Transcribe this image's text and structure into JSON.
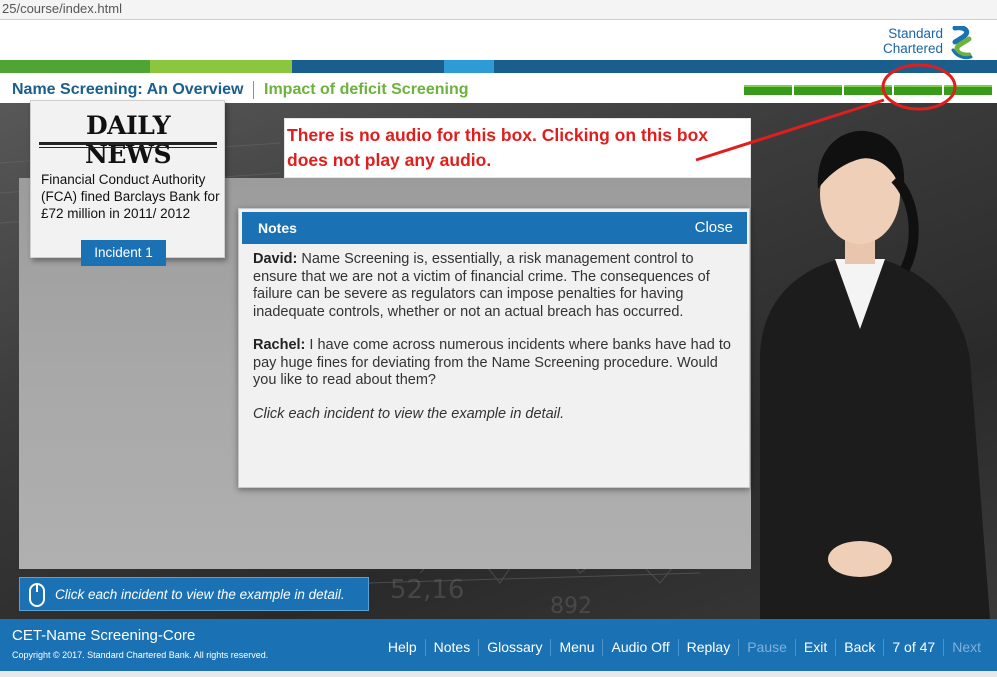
{
  "browser": {
    "url_fragment": "25/course/index.html"
  },
  "brand": {
    "line1": "Standard",
    "line2": "Chartered",
    "accent_blue": "#1a72b5",
    "accent_green": "#6cb23c"
  },
  "header": {
    "module_title": "Name Screening: An Overview",
    "page_title": "Impact of deficit Screening",
    "progress_segments": 5
  },
  "annotation": {
    "text": "There is no audio for this box. Clicking on this box does not play any audio.",
    "color": "#e01e1e"
  },
  "news_card": {
    "masthead": "DAILY NEWS",
    "body": "Financial Conduct Authority (FCA) fined Barclays Bank for £72 million in 2011/ 2012",
    "button_label": "Incident 1"
  },
  "notes": {
    "title": "Notes",
    "close_label": "Close",
    "speaker1": "David:",
    "text1": "Name Screening is, essentially, a risk management control to ensure that we are not a victim of financial crime. The consequences of failure can be severe as regulators can impose penalties for having inadequate controls, whether or not an actual breach has occurred.",
    "speaker2": "Rachel:",
    "text2": "I have come across numerous incidents where banks have had to pay huge fines for deviating from the Name Screening procedure. Would you like to read about them?",
    "instruction": "Click each incident to view the example in detail."
  },
  "hint": {
    "text": "Click each incident to view the example in detail."
  },
  "footer": {
    "course_title": "CET-Name Screening-Core",
    "copyright": "Copyright © 2017. Standard Chartered Bank. All rights reserved.",
    "nav": {
      "help": "Help",
      "notes": "Notes",
      "glossary": "Glossary",
      "menu": "Menu",
      "audio": "Audio Off",
      "replay": "Replay",
      "pause": "Pause",
      "exit": "Exit",
      "back": "Back",
      "page": "7 of 47",
      "next": "Next"
    }
  }
}
